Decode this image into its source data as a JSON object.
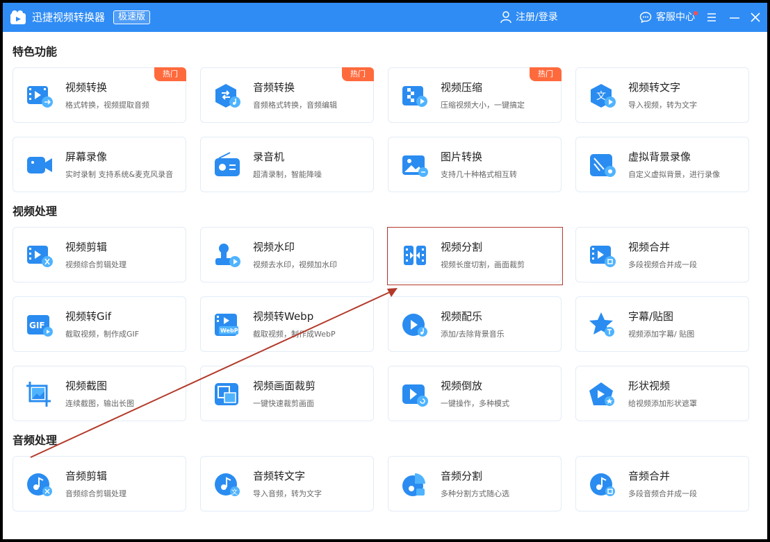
{
  "app": {
    "title": "迅捷视频转换器",
    "edition": "极速版",
    "login_label": "注册/登录",
    "service_label": "客服中心"
  },
  "colors": {
    "titlebar": "#2f8cf5",
    "icon_blue": "#2a8cf0",
    "hot_badge": "#ff6a3d",
    "annotation_red": "#b33a2a"
  },
  "sections": [
    {
      "title": "特色功能",
      "cards": [
        {
          "name": "视频转换",
          "desc": "格式转换，视频提取音频",
          "badge": "热门",
          "icon": "video-convert-icon"
        },
        {
          "name": "音频转换",
          "desc": "音频格式转换，音频编辑",
          "badge": "热门",
          "icon": "audio-convert-icon"
        },
        {
          "name": "视频压缩",
          "desc": "压缩视频大小，一键搞定",
          "badge": "热门",
          "icon": "video-compress-icon"
        },
        {
          "name": "视频转文字",
          "desc": "导入视频，转为文字",
          "icon": "video-to-text-icon"
        },
        {
          "name": "屏幕录像",
          "desc": "实时录制 支持系统&麦克风录音",
          "icon": "screen-record-icon"
        },
        {
          "name": "录音机",
          "desc": "超清录制，智能降噪",
          "icon": "recorder-icon"
        },
        {
          "name": "图片转换",
          "desc": "支持几十种格式相互转",
          "icon": "image-convert-icon"
        },
        {
          "name": "虚拟背景录像",
          "desc": "自定义虚拟背景，进行录像",
          "icon": "virtual-background-icon"
        }
      ]
    },
    {
      "title": "视频处理",
      "cards": [
        {
          "name": "视频剪辑",
          "desc": "视频综合剪辑处理",
          "icon": "video-edit-icon"
        },
        {
          "name": "视频水印",
          "desc": "视频去水印，视频加水印",
          "icon": "watermark-icon"
        },
        {
          "name": "视频分割",
          "desc": "视频长度切割，画面裁剪",
          "icon": "video-split-icon"
        },
        {
          "name": "视频合并",
          "desc": "多段视频合并成一段",
          "icon": "video-merge-icon"
        },
        {
          "name": "视频转Gif",
          "desc": "截取视频，制作成GIF",
          "icon_text": "GIF",
          "icon": "gif-icon"
        },
        {
          "name": "视频转Webp",
          "desc": "截取视频，制作成WebP",
          "icon_text": "WebP",
          "icon": "webp-icon"
        },
        {
          "name": "视频配乐",
          "desc": "添加/去除背景音乐",
          "icon": "music-icon"
        },
        {
          "name": "字幕/贴图",
          "desc": "视频添加字幕/ 贴图",
          "icon": "subtitle-star-icon"
        },
        {
          "name": "视频截图",
          "desc": "连续截图，输出长图",
          "icon": "screenshot-icon"
        },
        {
          "name": "视频画面裁剪",
          "desc": "一键快速裁剪画面",
          "icon": "crop-icon"
        },
        {
          "name": "视频倒放",
          "desc": "一键操作，多种模式",
          "icon": "reverse-icon"
        },
        {
          "name": "形状视频",
          "desc": "给视频添加形状遮罩",
          "icon": "shape-icon"
        }
      ]
    },
    {
      "title": "音频处理",
      "cards": [
        {
          "name": "音频剪辑",
          "desc": "音频综合剪辑处理",
          "icon": "audio-edit-icon"
        },
        {
          "name": "音频转文字",
          "desc": "导入音频，转为文字",
          "icon_text": "文",
          "icon": "audio-to-text-icon"
        },
        {
          "name": "音频分割",
          "desc": "多种分割方式随心选",
          "icon": "audio-split-icon"
        },
        {
          "name": "音频合并",
          "desc": "多段音频合并成一段",
          "icon": "audio-merge-icon"
        }
      ]
    }
  ]
}
